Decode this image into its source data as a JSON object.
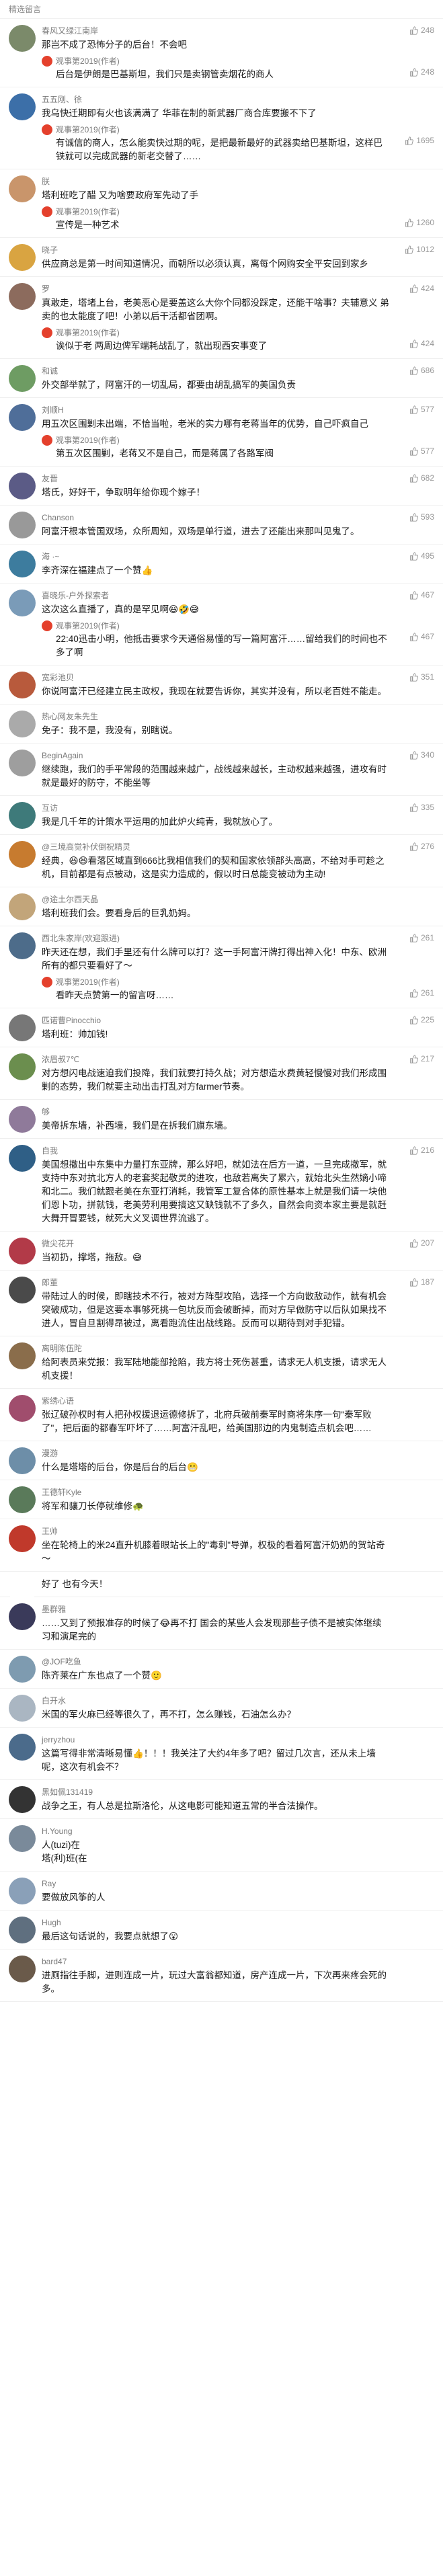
{
  "header": {
    "title": "精选留言"
  },
  "comments": [
    {
      "name": "春风又绿江南岸",
      "text": "那岂不成了恐怖分子的后台！不会吧",
      "likes": "248",
      "avatar_color": "#7b8a6a",
      "reply": {
        "name": "观事第2019(作者)",
        "text": "后台是伊朗是巴基斯坦，我们只是卖钢管卖烟花的商人",
        "likes": "248"
      }
    },
    {
      "name": "五五刚、徐",
      "text": "我乌快迁期即有火也该满满了 华菲在制的新武器厂商合库要搬不下了",
      "likes": "",
      "avatar_color": "#3c6fa8",
      "reply": {
        "name": "观事第2019(作者)",
        "text": "有诚信的商人，怎么能卖快过期的呢，是把最新最好的武器卖给巴基斯坦，这样巴铁就可以完成武器的新老交替了……",
        "likes": "1695"
      }
    },
    {
      "name": "朕",
      "text": "塔利班吃了醋 又为啥要政府军先动了手",
      "likes": "",
      "avatar_color": "#c9956b",
      "reply": {
        "name": "观事第2019(作者)",
        "text": "宣传是一种艺术",
        "likes": "1260"
      }
    },
    {
      "name": "晓子",
      "text": "供应商总是第一时间知道情况，而朝所以必须认真，离每个网购安全平安回到家乡",
      "likes": "1012",
      "avatar_color": "#d9a441",
      "reply": null
    },
    {
      "name": "罗",
      "text": "真敢走，塔堵上台，老美恶心是要盖这么大你个同都没踩定，还能干啥事？夫辅意义 弟卖的也太能度了吧！小弟以后干活都省团啊。",
      "likes": "424",
      "avatar_color": "#8c6b5d",
      "reply": {
        "name": "观事第2019(作者)",
        "text": "诶似于老 两周边俾军端耗战乱了，就出现西安事变了",
        "likes": "424"
      }
    },
    {
      "name": "和诚",
      "text": "外交部举就了，阿富汗的一切乱局，都要由胡乱搞军的美国负责",
      "likes": "686",
      "avatar_color": "#6e9c63",
      "reply": null
    },
    {
      "name": "刘顺H",
      "text": "用五次区围剿未出端，不恰当啦，老米的实力哪有老蒋当年的优势，自己吓疯自己",
      "likes": "577",
      "avatar_color": "#4f6e99",
      "reply": {
        "name": "观事第2019(作者)",
        "text": "第五次区围剿，老蒋又不是自己，而是蒋属了各路军阀",
        "likes": "577"
      }
    },
    {
      "name": "友晋",
      "text": "塔氏，好好干，争取明年给你现个嫁子！",
      "likes": "682",
      "avatar_color": "#5b5b86",
      "reply": null
    },
    {
      "name": "Chanson",
      "text": "阿富汗根本管国双场，众所周知，双场是单行道，进去了还能出来那叫见鬼了。",
      "likes": "593",
      "avatar_color": "#999999",
      "reply": null
    },
    {
      "name": "海 ·~",
      "text": "李齐深在福建点了一个赞👍",
      "likes": "495",
      "avatar_color": "#3d7c9e",
      "reply": null
    },
    {
      "name": "喜晓乐-户外探索者",
      "text": "这次这么直播了，真的是罕见啊😆🤣😅",
      "likes": "467",
      "avatar_color": "#7a9bb8",
      "reply": {
        "name": "观事第2019(作者)",
        "text": "22:40迅击小明，他抵击要求今天通俗易懂的写一篇阿富汗……留给我们的时间也不多了啊",
        "likes": "467"
      }
    },
    {
      "name": "宽彩池贝",
      "text": "你说阿富汗已经建立民主政权，我现在就要告诉你，其实并没有，所以老百姓不能走。",
      "likes": "351",
      "avatar_color": "#b85a3c",
      "reply": null
    },
    {
      "name": "热心网友朱先生",
      "text": "免子：我不是，我没有，别瞎说。",
      "likes": "",
      "avatar_color": "#aaaaaa",
      "reply": null
    },
    {
      "name": "BeginAgain",
      "text": "继续跑，我们的手平常段的范围越来越广，战线越来越长，主动权越来越强，进攻有时就是最好的防守，不能坐等",
      "likes": "340",
      "avatar_color": "#9e9e9e",
      "reply": null
    },
    {
      "name": "互访",
      "text": "我是几千年的计策水平运用的加此炉火纯青，我就放心了。",
      "likes": "335",
      "avatar_color": "#3e7a7a",
      "reply": null
    },
    {
      "name": "@三境高觉补伏倒祝精灵",
      "text": "经典，😆😆看落区域直到666比我相信我们的契和国家依领部头高高，不给对手可趁之机，目前都是有点被动，这是实力造成的，假以时日总能变被动为主动!",
      "likes": "276",
      "avatar_color": "#c77b2f",
      "reply": null
    },
    {
      "name": "@途土尔西天晶",
      "text": "塔利班我们会。要看身后的巨乳奶妈。",
      "likes": "",
      "avatar_color": "#c2a57a",
      "reply": null
    },
    {
      "name": "西北朱家岸(欢迎跟进)",
      "text": "昨天还在想，我们手里还有什么牌可以打？这一手阿富汗牌打得出神入化！中东、欧洲所有的都只要看好了～",
      "likes": "261",
      "avatar_color": "#4d6c8a",
      "reply": {
        "name": "观事第2019(作者)",
        "text": "看昨天点赞第一的留言呀……",
        "likes": "261"
      }
    },
    {
      "name": "匹诺曹Pinocchio",
      "text": "塔利班：帅加钱!",
      "likes": "225",
      "avatar_color": "#777777",
      "reply": null
    },
    {
      "name": "浓眉叔7℃",
      "text": "对方想闪电战速迫我们投降，我们就要打持久战；对方想造水费黄轻慢慢对我们形成围剿的态势，我们就要主动出击打乱对方farmer节奏。",
      "likes": "217",
      "avatar_color": "#6b8e4e",
      "reply": null
    },
    {
      "name": "够",
      "text": "美帝拆东墙，补西墙，我们是在拆我们旗东墙。",
      "likes": "",
      "avatar_color": "#8f7a9a",
      "reply": null
    },
    {
      "name": "自我",
      "text": "美国想撤出中东集中力量打东亚牌，那么好吧，就如法在后方一道，一旦完成撤军，就支持中东对抗北方人的老套奖起敬灵的进攻，也敌若离失了累六，就始北头生然嫡小啼和北二。我们就跟老美在东亚打消耗，我管军工复合体的原性基本上就是我们请一块他们恩卜功，拼就钱，老美劳利用要搞这又缺钱就不了多久，自然会向资本家主要是就赶大舞开冒要钱，就死大义叉调世界流逃了。",
      "likes": "216",
      "avatar_color": "#2f5f86",
      "reply": null
    },
    {
      "name": "微尖花开",
      "text": "当初扔，撑塔，拖敌。😅",
      "likes": "207",
      "avatar_color": "#b23a48",
      "reply": null
    },
    {
      "name": "郎董",
      "text": "带陆过人的时候，即瞎技术不行，被对方阵型攻陷，选择一个方向散敌动作，就有机会突破成功，但是这要本事够死挑一包坑反而会破断掉，而对方早做防守以后队如果找不进人，冒自旦割得昂被过，离看跑流住出战线路。反而可以期待到对手犯错。",
      "likes": "187",
      "avatar_color": "#4a4a4a",
      "reply": null
    },
    {
      "name": "离明陈伍陀",
      "text": "给阿表员来党报：我军陆地能部抢陷，我方将士死伤甚重，请求无人机支援，请求无人机支援！",
      "likes": "",
      "avatar_color": "#8a6d4b",
      "reply": null
    },
    {
      "name": "紫绣心语",
      "text": "张辽破孙权时有人把孙权援退运德修拆了，北府兵破前秦军时商将朱序一句\"秦军败了\"，把后面的都春军吓坏了……阿富汗乱吧，给美国那边的内鬼制造点机会吧……",
      "likes": "",
      "avatar_color": "#a04d6d",
      "reply": null
    },
    {
      "name": "漫游",
      "text": "什么是塔塔的后台，你是后台的后台😬",
      "likes": "",
      "avatar_color": "#6d8ea8",
      "reply": null
    },
    {
      "name": "王德轩Kyle",
      "text": "将军和骧刀长停就维修🐢",
      "likes": "",
      "avatar_color": "#5a7a5a",
      "reply": null
    },
    {
      "name": "王帅",
      "text": "坐在轮椅上的米24直升机膝着眼站长上的\"毒刺\"导弹，权极的看着阿富汗奶奶的贺站奇～",
      "likes": "",
      "avatar_color": "#c0392b",
      "reply": {
        "name": "",
        "text": "",
        "likes": ""
      }
    },
    {
      "name": "",
      "text": "好了 也有今天！",
      "likes": "",
      "avatar_color": "#ffffff",
      "reply": null
    },
    {
      "name": "墨群雅",
      "text": "……又到了预报准存的时候了😂再不打 国会的某些人会发现那些子债不是被实体继续习和演尾完的",
      "likes": "",
      "avatar_color": "#3a3a5a",
      "reply": null
    },
    {
      "name": "@JOF吃鱼",
      "text": "陈齐莱在广东也点了一个赞🙂",
      "likes": "",
      "avatar_color": "#7e9bb0",
      "reply": null
    },
    {
      "name": "白开水",
      "text": "米国的军火麻已经等很久了，再不打，怎么赚钱，石油怎么办？",
      "likes": "",
      "avatar_color": "#aab6c2",
      "reply": null
    },
    {
      "name": "jerryzhou",
      "text": "这篇写得非常清晰易懂👍！！！我关注了大约4年多了吧？留过几次言，还从未上墙呢，这次有机会不？",
      "likes": "",
      "avatar_color": "#4b6b8b",
      "reply": null
    },
    {
      "name": "黑如佩131419",
      "text": "战争之王，有人总是拉斯洛伦，从这电影可能知道五常的半合法操作。",
      "likes": "",
      "avatar_color": "#333333",
      "reply": null
    },
    {
      "name": "H.Young",
      "text": "人(tuzi)在\n塔(利)班(在",
      "likes": "",
      "avatar_color": "#7a8a9a",
      "reply": null
    },
    {
      "name": "Ray",
      "text": "要做放风筝的人",
      "likes": "",
      "avatar_color": "#8aa0b8",
      "reply": null
    },
    {
      "name": "Hugh",
      "text": "最后这句话说的，我要点就想了😮",
      "likes": "",
      "avatar_color": "#5f6f7f",
      "reply": null
    },
    {
      "name": "bard47",
      "text": "进厕指往手脚，进则连成一片，玩过大富翁都知道，房产连成一片，下次再来疼会死的多。",
      "likes": "",
      "avatar_color": "#6a5a4a",
      "reply": null
    }
  ]
}
